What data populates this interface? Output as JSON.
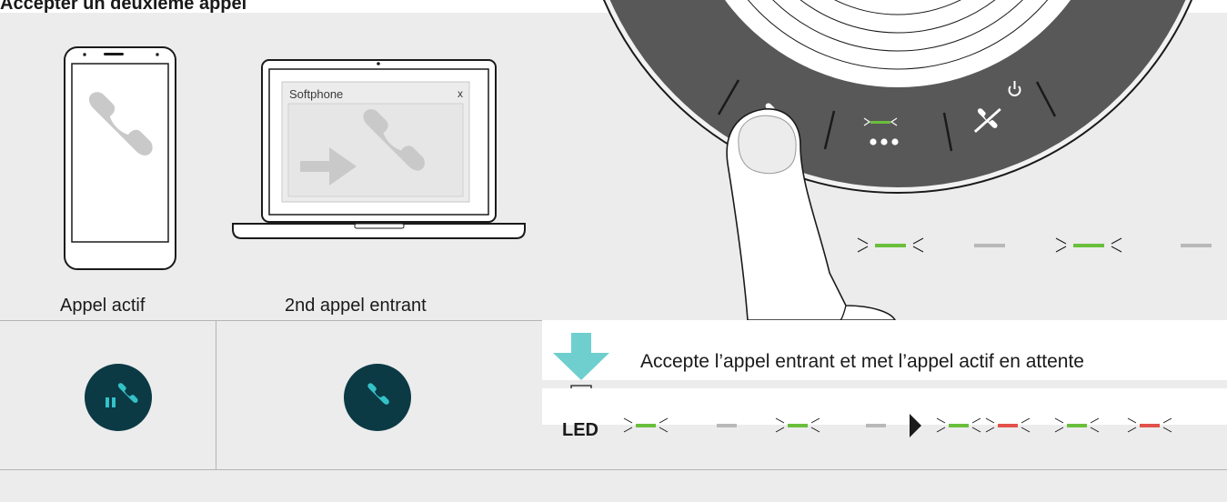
{
  "page": {
    "title": "Accepter un deuxième appel"
  },
  "devices": {
    "phone_label": "Appel actif",
    "laptop_label": "2nd appel entrant",
    "softphone_title": "Softphone",
    "softphone_close": "x"
  },
  "action": {
    "text": "Accepte l’appel entrant et met l’appel actif en attente"
  },
  "led": {
    "label": "LED",
    "sequence_before": [
      "green-flash",
      "gray",
      "green-flash",
      "gray"
    ],
    "sequence_after": [
      "green-flash",
      "red-flash",
      "green-flash",
      "red-flash"
    ]
  },
  "colors": {
    "teal_dark": "#0b3a45",
    "teal_icon": "#34c2c8",
    "arrow": "#6fcfcf",
    "led_green": "#6abf3c",
    "led_red": "#e2524b",
    "led_gray": "#b8b8b8",
    "speaker_ring": "#5a5a5a"
  },
  "icons": {
    "phone_status": "call-hold-icon",
    "laptop_status": "call-accept-icon",
    "speaker_buttons": [
      "phone-icon",
      "more-icon",
      "hangup-icon",
      "power-icon"
    ]
  }
}
